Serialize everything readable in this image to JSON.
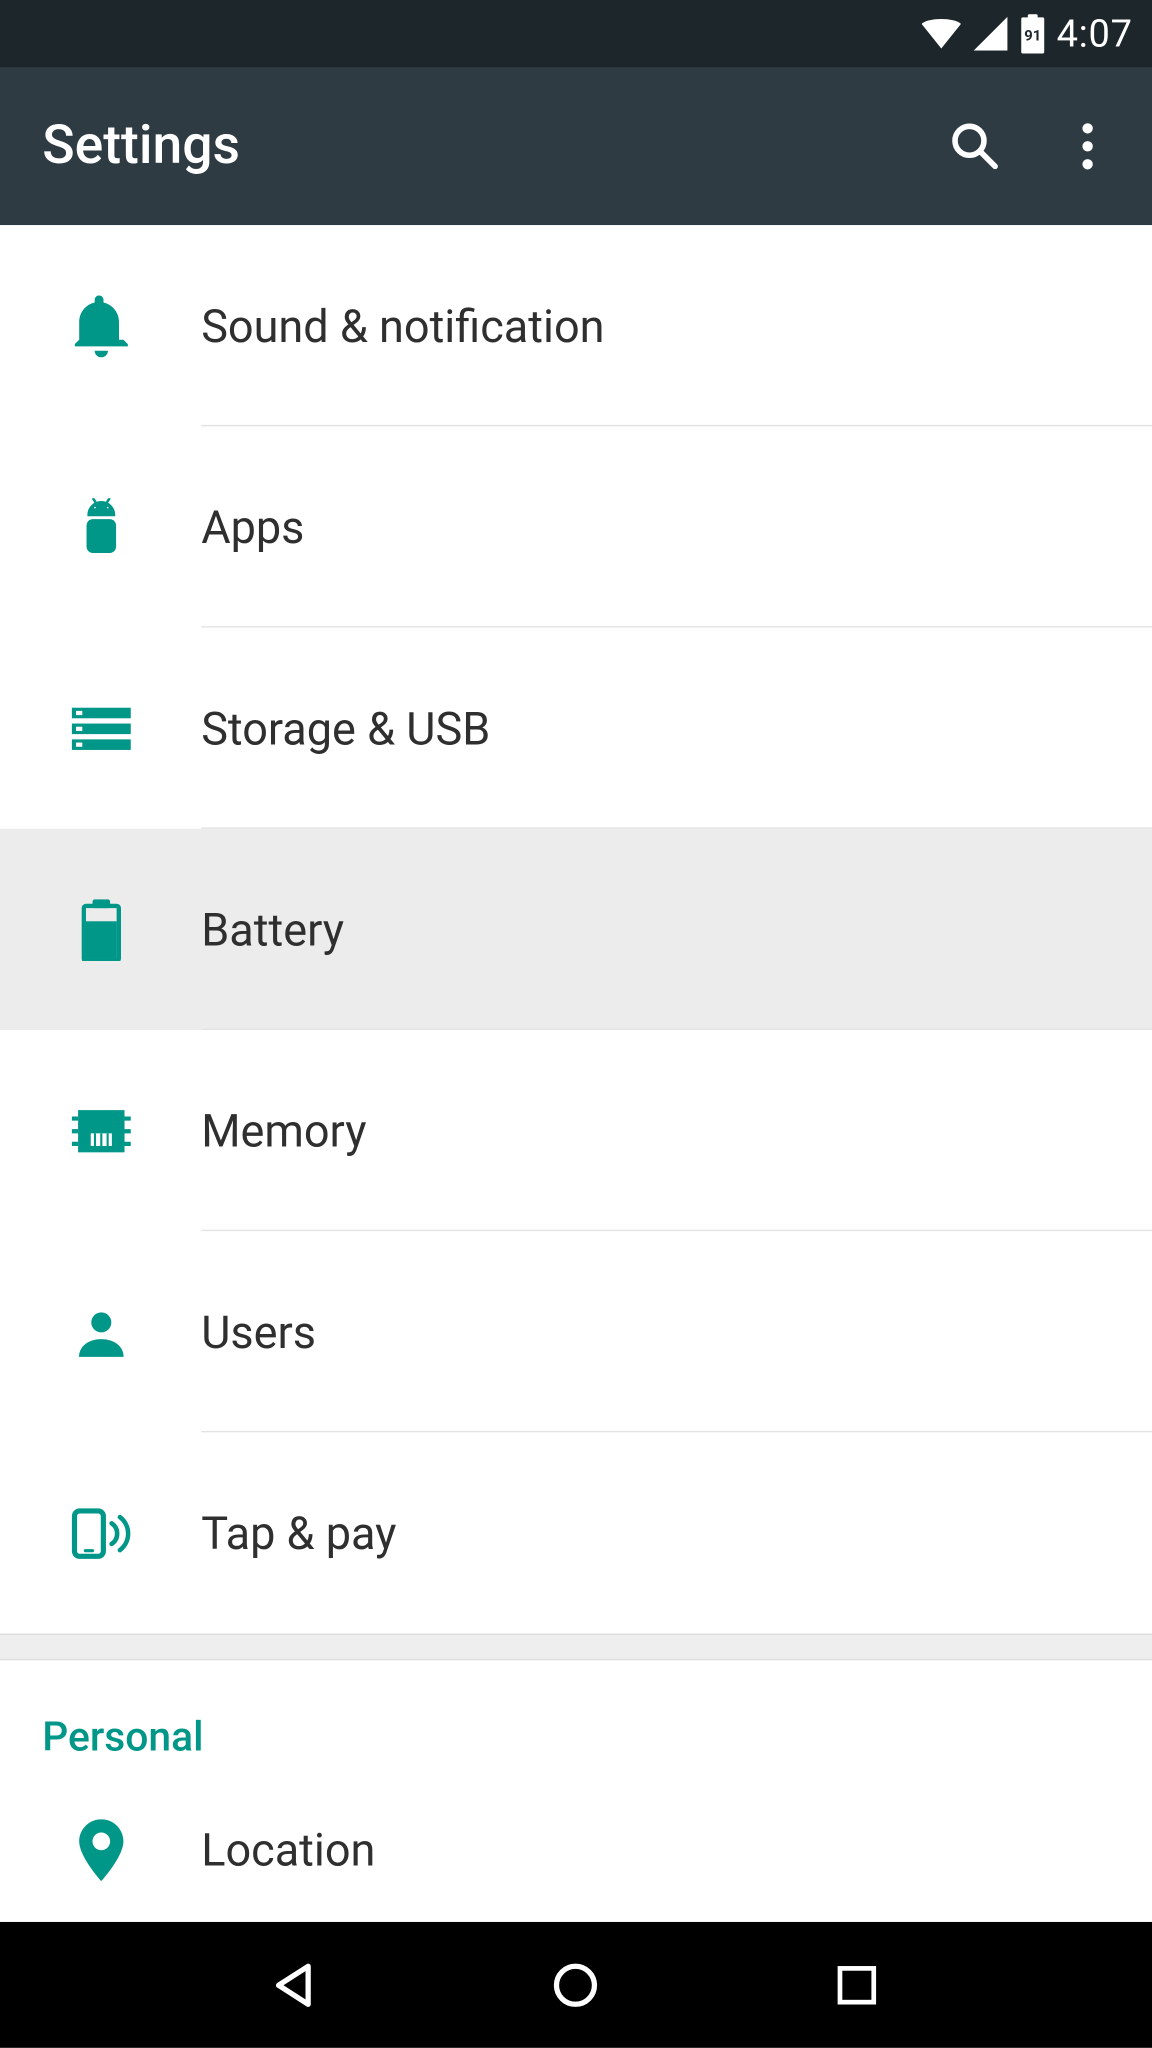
{
  "status": {
    "battery_text": "91",
    "time": "4:07"
  },
  "appbar": {
    "title": "Settings"
  },
  "items": [
    {
      "icon": "bell",
      "label": "Sound & notification",
      "selected": false,
      "divider": true
    },
    {
      "icon": "android",
      "label": "Apps",
      "selected": false,
      "divider": true
    },
    {
      "icon": "storage",
      "label": "Storage & USB",
      "selected": false,
      "divider": true
    },
    {
      "icon": "battery",
      "label": "Battery",
      "selected": true,
      "divider": true
    },
    {
      "icon": "memory",
      "label": "Memory",
      "selected": false,
      "divider": true
    },
    {
      "icon": "person",
      "label": "Users",
      "selected": false,
      "divider": true
    },
    {
      "icon": "tap",
      "label": "Tap & pay",
      "selected": false,
      "divider": false
    }
  ],
  "section": {
    "title": "Personal"
  },
  "personal_items": [
    {
      "icon": "location",
      "label": "Location"
    }
  ]
}
